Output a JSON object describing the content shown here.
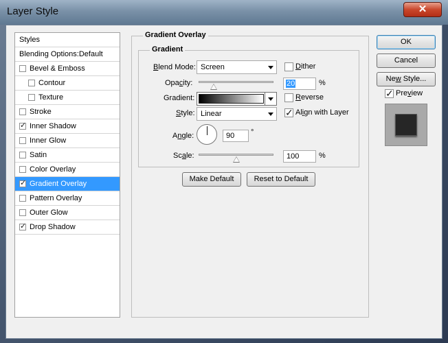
{
  "window": {
    "title": "Layer Style",
    "close_glyph": "✕"
  },
  "styles_panel": {
    "header": "Styles",
    "blending_options": "Blending Options:Default",
    "items": [
      {
        "label": "Bevel & Emboss",
        "checked": false,
        "indent": 0,
        "selected": false
      },
      {
        "label": "Contour",
        "checked": false,
        "indent": 1,
        "selected": false
      },
      {
        "label": "Texture",
        "checked": false,
        "indent": 1,
        "selected": false
      },
      {
        "label": "Stroke",
        "checked": false,
        "indent": 0,
        "selected": false
      },
      {
        "label": "Inner Shadow",
        "checked": true,
        "indent": 0,
        "selected": false
      },
      {
        "label": "Inner Glow",
        "checked": false,
        "indent": 0,
        "selected": false
      },
      {
        "label": "Satin",
        "checked": false,
        "indent": 0,
        "selected": false
      },
      {
        "label": "Color Overlay",
        "checked": false,
        "indent": 0,
        "selected": false
      },
      {
        "label": "Gradient Overlay",
        "checked": true,
        "indent": 0,
        "selected": true
      },
      {
        "label": "Pattern Overlay",
        "checked": false,
        "indent": 0,
        "selected": false
      },
      {
        "label": "Outer Glow",
        "checked": false,
        "indent": 0,
        "selected": false
      },
      {
        "label": "Drop Shadow",
        "checked": true,
        "indent": 0,
        "selected": false
      }
    ]
  },
  "gradient_overlay": {
    "section_title": "Gradient Overlay",
    "group_title": "Gradient",
    "blend_mode": {
      "label_pre": "",
      "label_u": "B",
      "label_post": "lend Mode:",
      "value": "Screen"
    },
    "dither": {
      "label_u": "D",
      "label_post": "ither",
      "checked": false
    },
    "opacity": {
      "label_pre": "Opa",
      "label_u": "c",
      "label_post": "ity:",
      "value": "20",
      "unit": "%",
      "slider_fraction": 0.2
    },
    "gradient": {
      "label": "Gradient:",
      "from_color": "#000000",
      "to_color": "#ffffff"
    },
    "reverse": {
      "label_u": "R",
      "label_post": "everse",
      "checked": false
    },
    "style": {
      "label_pre": "",
      "label_u": "S",
      "label_post": "tyle:",
      "value": "Linear"
    },
    "align_with_layer": {
      "label_pre": "Al",
      "label_u": "i",
      "label_post": "gn with Layer",
      "checked": true
    },
    "angle": {
      "label_pre": "A",
      "label_u": "n",
      "label_post": "gle:",
      "value": "90",
      "unit": "°"
    },
    "scale": {
      "label_pre": "Sc",
      "label_u": "a",
      "label_post": "le:",
      "value": "100",
      "unit": "%",
      "slider_fraction": 0.5
    },
    "make_default": "Make Default",
    "reset_to_default": "Reset to Default"
  },
  "right_panel": {
    "ok": "OK",
    "cancel": "Cancel",
    "new_style_pre": "Ne",
    "new_style_u": "w",
    "new_style_post": " Style...",
    "preview_pre": "Pre",
    "preview_u": "v",
    "preview_post": "iew",
    "preview_checked": true
  },
  "colors": {
    "selection": "#3399ff",
    "titlebar": "#7a91a8",
    "close_button": "#c9472c",
    "dialog_bg": "#f0f0f0"
  }
}
